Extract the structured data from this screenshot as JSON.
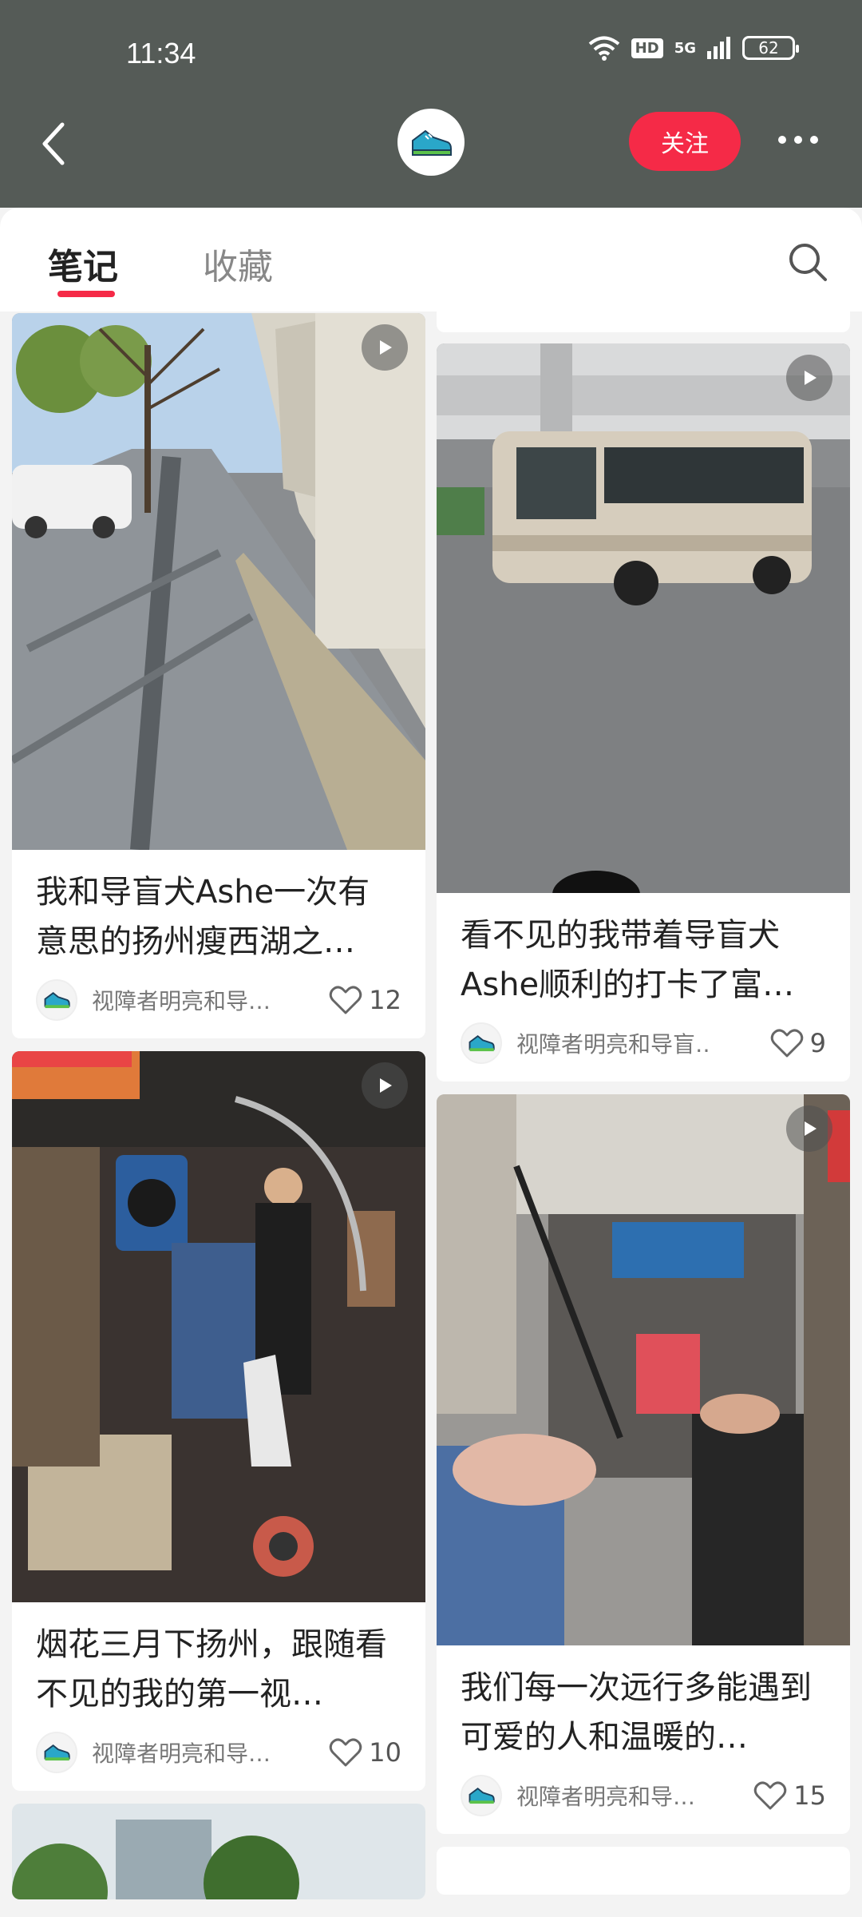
{
  "status_bar": {
    "time": "11:34",
    "hd": "HD",
    "network": "5G",
    "battery": "62"
  },
  "header": {
    "follow_label": "关注"
  },
  "tabs": {
    "notes": "笔记",
    "favorites": "收藏"
  },
  "colors": {
    "accent": "#f52a47",
    "header_bg": "#555b57"
  },
  "left_column": [
    {
      "title": "我和导盲犬Ashe一次有意思的扬州瘦西湖之…",
      "author": "视障者明亮和导…",
      "likes": "12"
    },
    {
      "title": "烟花三月下扬州，跟随看不见的我的第一视…",
      "author": "视障者明亮和导…",
      "likes": "10"
    }
  ],
  "right_column": [
    {
      "title": "看不见的我带着导盲犬Ashe顺利的打卡了富…",
      "author": "视障者明亮和导盲…",
      "likes": "9"
    },
    {
      "title": "我们每一次远行多能遇到可爱的人和温暖的…",
      "author": "视障者明亮和导…",
      "likes": "15"
    }
  ],
  "icons": {
    "back": "chevron-left-icon",
    "more": "more-dots-icon",
    "search": "search-icon",
    "play": "play-icon",
    "like": "heart-icon"
  }
}
